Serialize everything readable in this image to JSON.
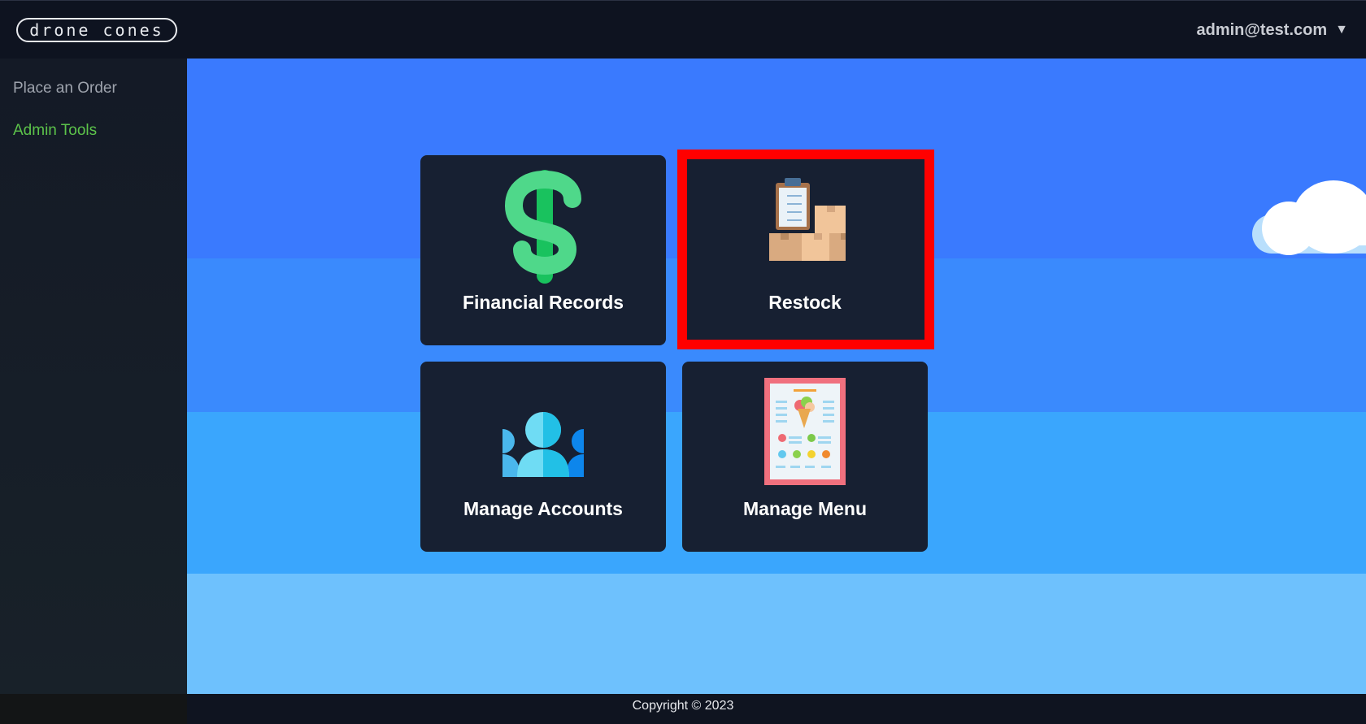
{
  "header": {
    "logo_text": "drone cones",
    "user_email": "admin@test.com",
    "caret": "▼"
  },
  "sidebar": {
    "items": [
      {
        "label": "Place an Order",
        "color": "#9ea3ad"
      },
      {
        "label": "Admin Tools",
        "color": "#5cc34a",
        "active": true
      }
    ]
  },
  "tiles": [
    {
      "label": "Financial Records",
      "icon": "dollar-icon"
    },
    {
      "label": "Restock",
      "icon": "boxes-clipboard-icon",
      "highlighted": true
    },
    {
      "label": "Manage Accounts",
      "icon": "people-icon"
    },
    {
      "label": "Manage Menu",
      "icon": "menu-card-icon"
    }
  ],
  "footer": {
    "copyright": "Copyright © 2023"
  },
  "colors": {
    "highlight": "#ff0000",
    "tile_bg": "#172032",
    "active_nav": "#5cc34a"
  }
}
